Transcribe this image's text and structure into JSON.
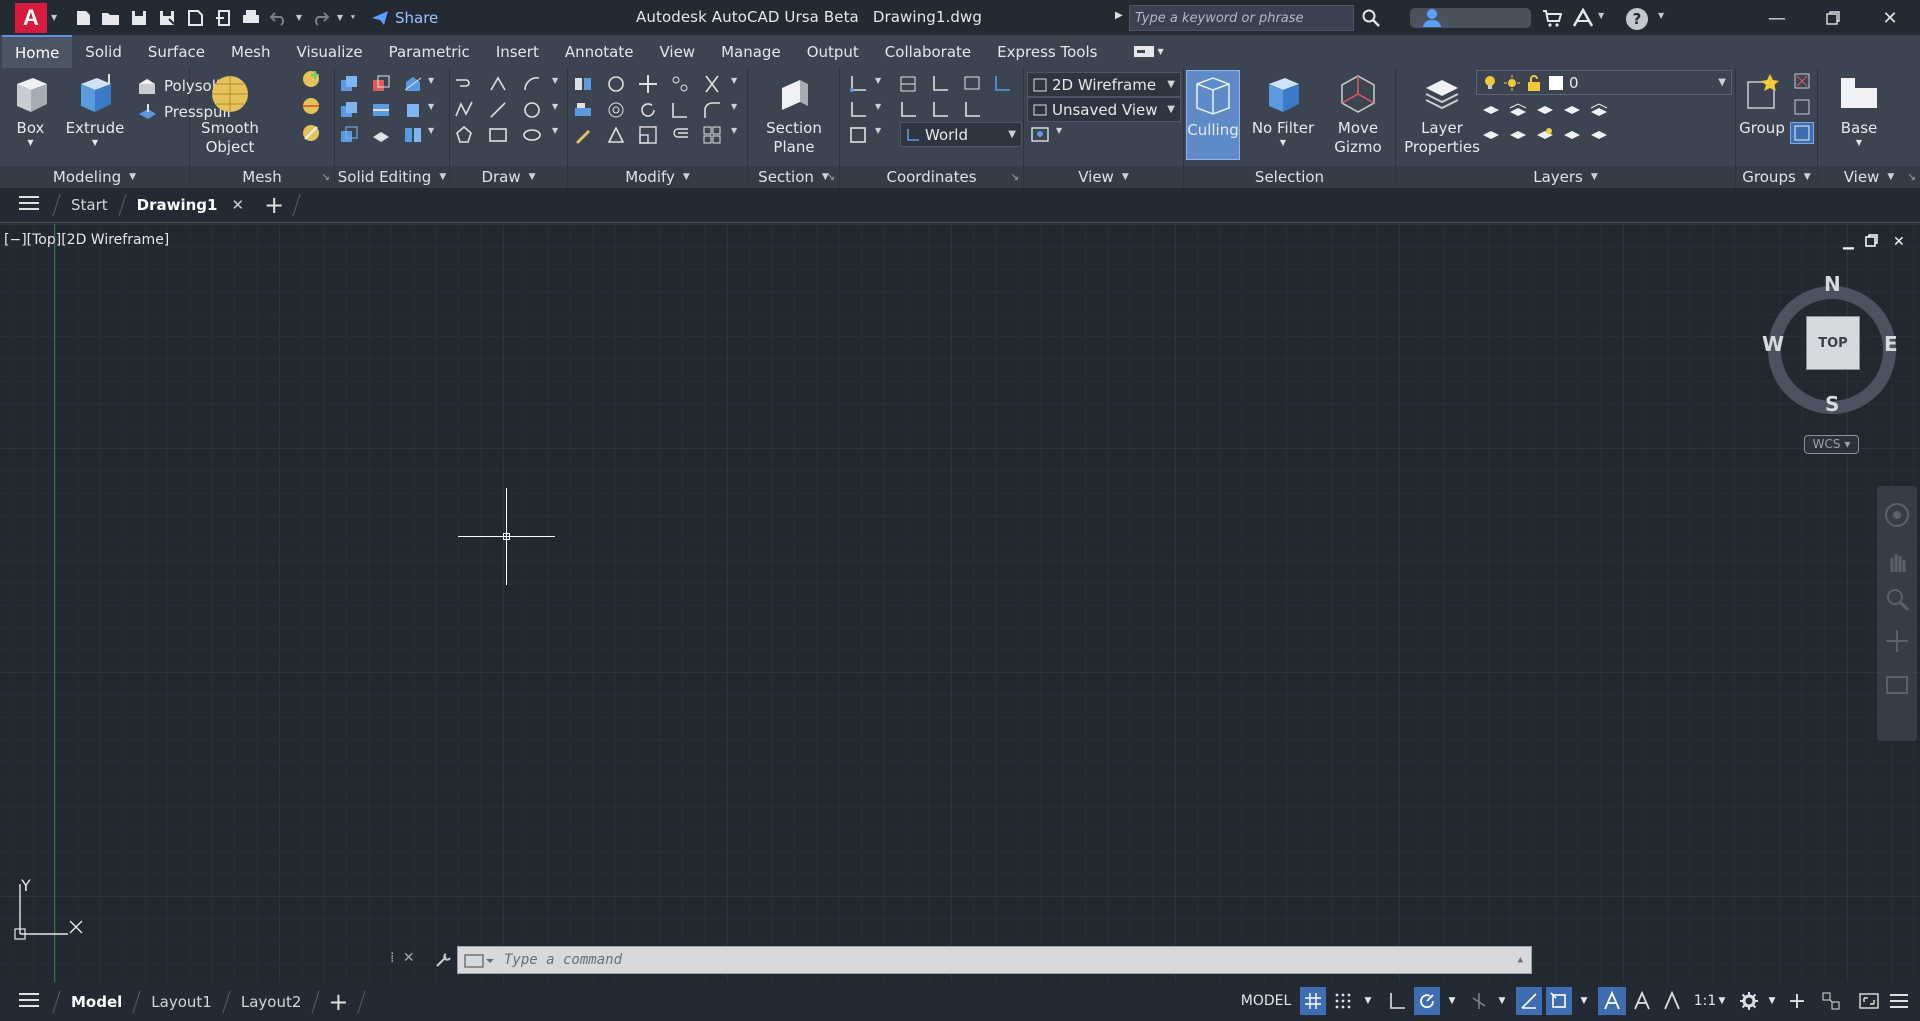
{
  "app_title": "Autodesk AutoCAD Ursa Beta",
  "file_name": "Drawing1.dwg",
  "logo_letter": "A",
  "share_label": "Share",
  "search": {
    "placeholder": "Type a keyword or phrase"
  },
  "ribbon_tabs": [
    "Home",
    "Solid",
    "Surface",
    "Mesh",
    "Visualize",
    "Parametric",
    "Insert",
    "Annotate",
    "View",
    "Manage",
    "Output",
    "Collaborate",
    "Express Tools"
  ],
  "panels": {
    "modeling": {
      "title": "Modeling",
      "box": "Box",
      "extrude": "Extrude",
      "polysolid": "Polysolid",
      "presspull": "Presspull"
    },
    "mesh": {
      "title": "Mesh",
      "smooth_object_1": "Smooth",
      "smooth_object_2": "Object"
    },
    "solid_editing": {
      "title": "Solid Editing"
    },
    "draw": {
      "title": "Draw"
    },
    "modify": {
      "title": "Modify"
    },
    "section": {
      "title": "Section",
      "section_plane_1": "Section",
      "section_plane_2": "Plane"
    },
    "coordinates": {
      "title": "Coordinates",
      "world": "World"
    },
    "view": {
      "title": "View",
      "visual_style": "2D Wireframe",
      "named_view": "Unsaved View"
    },
    "selection": {
      "title": "Selection",
      "culling": "Culling",
      "no_filter": "No Filter",
      "move_gizmo_1": "Move",
      "move_gizmo_2": "Gizmo"
    },
    "layers": {
      "title": "Layers",
      "layer_properties_1": "Layer",
      "layer_properties_2": "Properties",
      "current_layer": "0"
    },
    "groups": {
      "title": "Groups",
      "group": "Group"
    },
    "view2": {
      "title": "View",
      "base": "Base"
    }
  },
  "doc_tabs": {
    "start": "Start",
    "drawing": "Drawing1"
  },
  "viewport_label": "[−][Top][2D Wireframe]",
  "viewcube": {
    "top": "TOP",
    "n": "N",
    "s": "S",
    "e": "E",
    "w": "W",
    "wcs": "WCS"
  },
  "ucs": {
    "y": "Y"
  },
  "command_line": {
    "placeholder": "Type a command"
  },
  "layout_tabs": [
    "Model",
    "Layout1",
    "Layout2"
  ],
  "status": {
    "model": "MODEL",
    "scale": "1:1"
  }
}
